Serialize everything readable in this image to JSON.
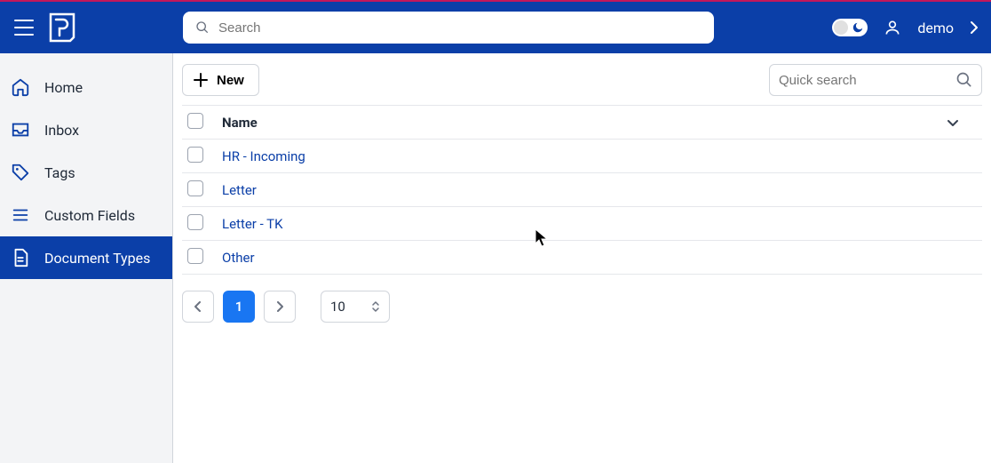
{
  "header": {
    "search_placeholder": "Search",
    "username": "demo"
  },
  "sidebar": {
    "items": [
      {
        "label": "Home",
        "icon": "home",
        "active": false
      },
      {
        "label": "Inbox",
        "icon": "inbox",
        "active": false
      },
      {
        "label": "Tags",
        "icon": "tag",
        "active": false
      },
      {
        "label": "Custom Fields",
        "icon": "list",
        "active": false
      },
      {
        "label": "Document Types",
        "icon": "doc",
        "active": true
      }
    ]
  },
  "toolbar": {
    "new_label": "New",
    "quick_search_placeholder": "Quick search"
  },
  "table": {
    "columns": {
      "name": "Name"
    },
    "rows": [
      {
        "name": "HR - Incoming"
      },
      {
        "name": "Letter"
      },
      {
        "name": "Letter - TK"
      },
      {
        "name": "Other"
      }
    ]
  },
  "pagination": {
    "current": "1",
    "page_size": "10"
  },
  "colors": {
    "accent": "#0b3fa8",
    "active_page": "#1976f2"
  }
}
